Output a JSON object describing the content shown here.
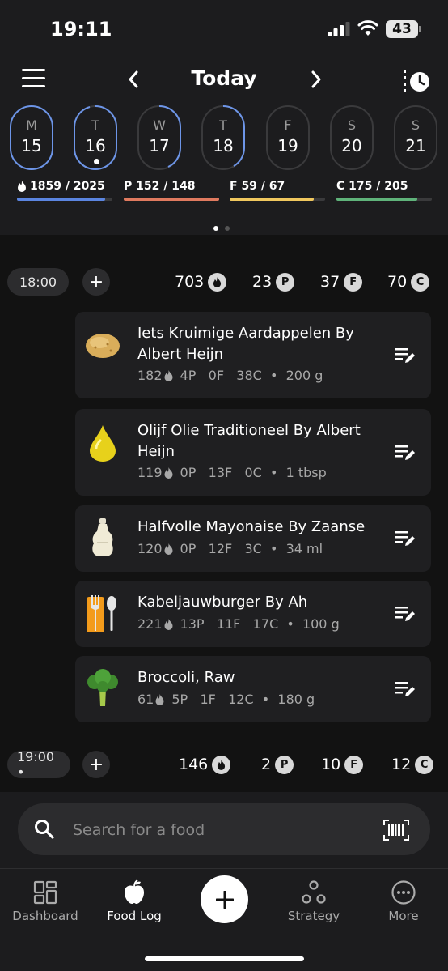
{
  "status": {
    "time": "19:11",
    "battery": "43"
  },
  "header": {
    "title": "Today"
  },
  "days": [
    {
      "letter": "M",
      "date": "15",
      "state": "full"
    },
    {
      "letter": "T",
      "date": "16",
      "state": "full-partial",
      "today_dot": true
    },
    {
      "letter": "W",
      "date": "17",
      "state": "partial"
    },
    {
      "letter": "T",
      "date": "18",
      "state": "partial"
    },
    {
      "letter": "F",
      "date": "19",
      "state": "empty"
    },
    {
      "letter": "S",
      "date": "20",
      "state": "empty"
    },
    {
      "letter": "S",
      "date": "21",
      "state": "empty"
    }
  ],
  "macros": [
    {
      "label": "1859 / 2025",
      "icon": "flame-icon",
      "color": "#5b85e0",
      "progress": 0.92
    },
    {
      "label": "P 152 / 148",
      "color": "#e07a5f",
      "progress": 1.0
    },
    {
      "label": "F 59 / 67",
      "color": "#f0c75e",
      "progress": 0.88
    },
    {
      "label": "C 175 / 205",
      "color": "#5fb37a",
      "progress": 0.85
    }
  ],
  "meals": [
    {
      "time": "18:00",
      "totals": {
        "kcal": "703",
        "p": "23",
        "f": "37",
        "c": "70"
      },
      "items": [
        {
          "name": "Iets Kruimige Aardappelen By Albert Heijn",
          "kcal": "182",
          "macros": "4P   0F   38C  •  200 g",
          "icon": "potato-icon"
        },
        {
          "name": "Olijf Olie Traditioneel By Albert Heijn",
          "kcal": "119",
          "macros": "0P   13F   0C  •  1 tbsp",
          "icon": "oil-drop-icon"
        },
        {
          "name": "Halfvolle Mayonaise By Zaanse",
          "kcal": "120",
          "macros": "0P   12F   3C  •  34 ml",
          "icon": "mayonnaise-bottle-icon"
        },
        {
          "name": "Kabeljauwburger By Ah",
          "kcal": "221",
          "macros": "13P   11F   17C  •  100 g",
          "icon": "cutlery-icon"
        },
        {
          "name": "Broccoli, Raw",
          "kcal": "61",
          "macros": "5P   1F   12C  •  180 g",
          "icon": "broccoli-icon"
        }
      ]
    },
    {
      "time": "19:00 •",
      "totals": {
        "kcal": "146",
        "p": "2",
        "f": "10",
        "c": "12"
      },
      "items": []
    }
  ],
  "badges": {
    "p": "P",
    "f": "F",
    "c": "C"
  },
  "search": {
    "placeholder": "Search for a food"
  },
  "nav": {
    "dashboard": "Dashboard",
    "food_log": "Food Log",
    "strategy": "Strategy",
    "more": "More"
  }
}
